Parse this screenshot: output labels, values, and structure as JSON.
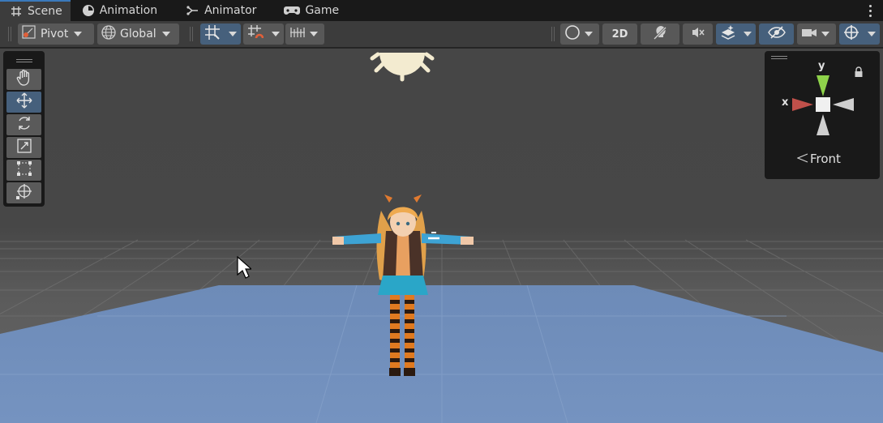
{
  "tabs": [
    {
      "label": "Scene",
      "icon": "grid-hash-icon",
      "active": true
    },
    {
      "label": "Animation",
      "icon": "clock-icon",
      "active": false
    },
    {
      "label": "Animator",
      "icon": "animator-graph-icon",
      "active": false
    },
    {
      "label": "Game",
      "icon": "gamepad-icon",
      "active": false
    }
  ],
  "toolbar": {
    "pivot_label": "Pivot",
    "global_label": "Global",
    "view_2d_label": "2D"
  },
  "tools": [
    "hand-tool",
    "move-tool",
    "rotate-tool",
    "scale-tool",
    "rect-tool",
    "transform-tool"
  ],
  "gizmo": {
    "y_label": "y",
    "x_label": "x",
    "view_label": "Front"
  },
  "colors": {
    "accent_blue": "#46607c",
    "ground_plane": "#6c8ab7",
    "axis_x": "#c0504a",
    "axis_y": "#8ed24a"
  }
}
